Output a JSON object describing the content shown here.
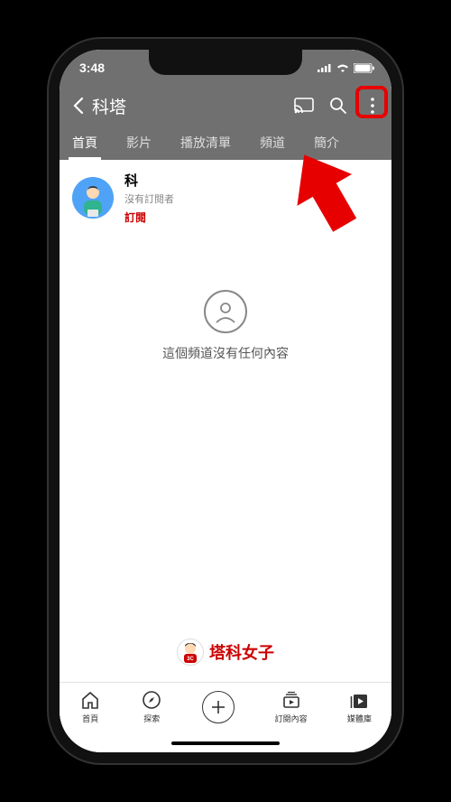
{
  "status": {
    "time": "3:48"
  },
  "header": {
    "title": "科塔",
    "icons": {
      "cast": "cast-icon",
      "search": "search-icon",
      "more": "more-vertical-icon"
    }
  },
  "tabs": [
    {
      "label": "首頁",
      "active": true
    },
    {
      "label": "影片",
      "active": false
    },
    {
      "label": "播放清單",
      "active": false
    },
    {
      "label": "頻道",
      "active": false
    },
    {
      "label": "簡介",
      "active": false
    }
  ],
  "channel": {
    "name": "科",
    "subscribers": "沒有訂閱者",
    "subscribe_label": "訂閱"
  },
  "empty_state": {
    "text": "這個頻道沒有任何內容"
  },
  "watermark": {
    "text": "塔科女子"
  },
  "bottom_nav": {
    "home": "首頁",
    "explore": "探索",
    "subscriptions": "訂閱內容",
    "library": "媒體庫"
  },
  "colors": {
    "accent_red": "#cc0000",
    "header_gray": "#707070"
  }
}
